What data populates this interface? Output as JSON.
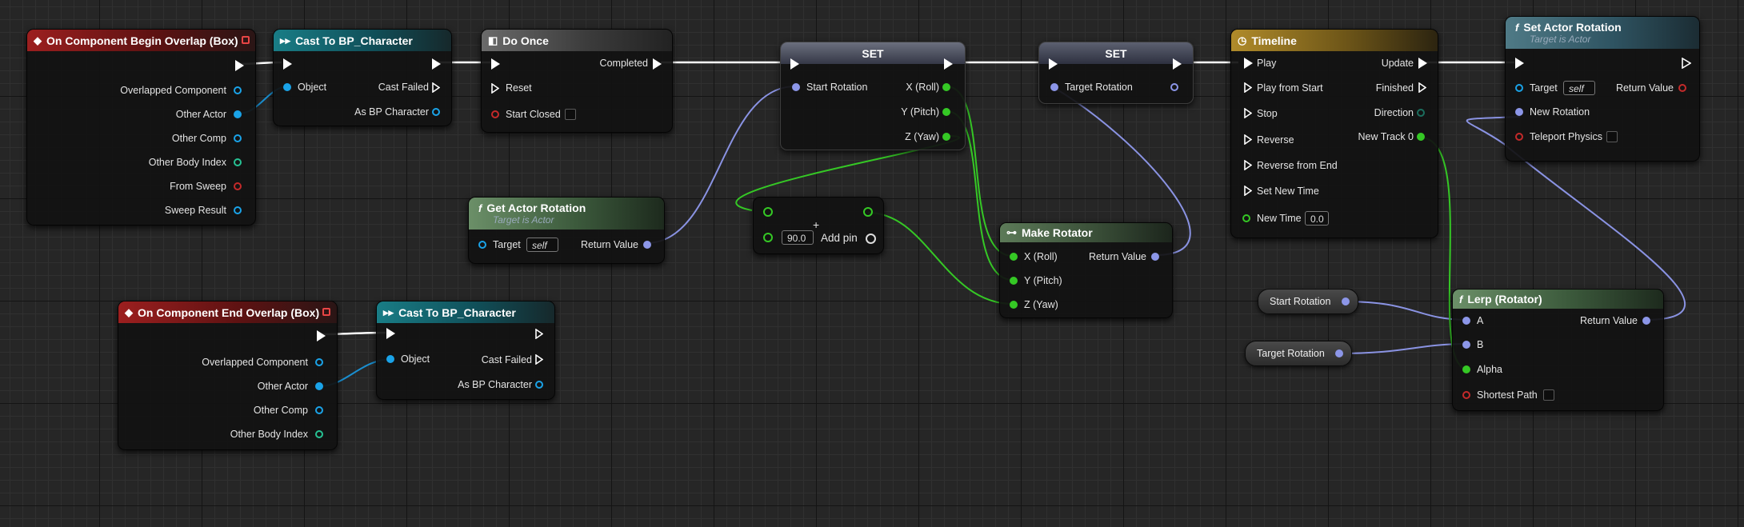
{
  "colors": {
    "exec": "#ffffff",
    "object": "#1aa3e8",
    "struct": "#8c96e8",
    "float": "#35c825",
    "bool": "#c42a2a",
    "int": "#27c294",
    "byte": "#1b6e5e"
  },
  "begin_overlap": {
    "title": "On Component Begin Overlap (Box)",
    "pins": [
      "Overlapped Component",
      "Other Actor",
      "Other Comp",
      "Other Body Index",
      "From Sweep",
      "Sweep Result"
    ]
  },
  "cast1": {
    "title": "Cast To BP_Character",
    "object": "Object",
    "cast_failed": "Cast Failed",
    "as_char": "As BP Character"
  },
  "do_once": {
    "title": "Do Once",
    "completed": "Completed",
    "reset": "Reset",
    "start_closed": "Start Closed"
  },
  "set1": {
    "title": "SET",
    "start_rotation": "Start Rotation",
    "x": "X (Roll)",
    "y": "Y (Pitch)",
    "z": "Z (Yaw)"
  },
  "set2": {
    "title": "SET",
    "target_rotation": "Target Rotation"
  },
  "get_rot": {
    "title": "Get Actor Rotation",
    "subtitle": "Target is Actor",
    "target": "Target",
    "self": "self",
    "ret": "Return Value"
  },
  "add_node": {
    "symbol": "+",
    "value": "90.0",
    "add_pin": "Add pin"
  },
  "make_rot": {
    "title": "Make Rotator",
    "x": "X (Roll)",
    "y": "Y (Pitch)",
    "z": "Z (Yaw)",
    "ret": "Return Value"
  },
  "end_overlap": {
    "title": "On Component End Overlap (Box)",
    "pins": [
      "Overlapped Component",
      "Other Actor",
      "Other Comp",
      "Other Body Index"
    ]
  },
  "cast2": {
    "title": "Cast To BP_Character",
    "object": "Object",
    "cast_failed": "Cast Failed",
    "as_char": "As BP Character"
  },
  "timeline": {
    "title": "Timeline",
    "inputs": [
      "Play",
      "Play from Start",
      "Stop",
      "Reverse",
      "Reverse from End",
      "Set New Time"
    ],
    "new_time": "New Time",
    "new_time_value": "0.0",
    "update": "Update",
    "finished": "Finished",
    "direction": "Direction",
    "new_track": "New Track 0"
  },
  "set_actor_rot": {
    "title": "Set Actor Rotation",
    "subtitle": "Target is Actor",
    "target": "Target",
    "self": "self",
    "new_rotation": "New Rotation",
    "teleport": "Teleport Physics",
    "ret": "Return Value"
  },
  "var_start": {
    "label": "Start Rotation"
  },
  "var_target": {
    "label": "Target Rotation"
  },
  "lerp": {
    "title": "Lerp (Rotator)",
    "a": "A",
    "b": "B",
    "alpha": "Alpha",
    "shortest": "Shortest Path",
    "ret": "Return Value"
  }
}
